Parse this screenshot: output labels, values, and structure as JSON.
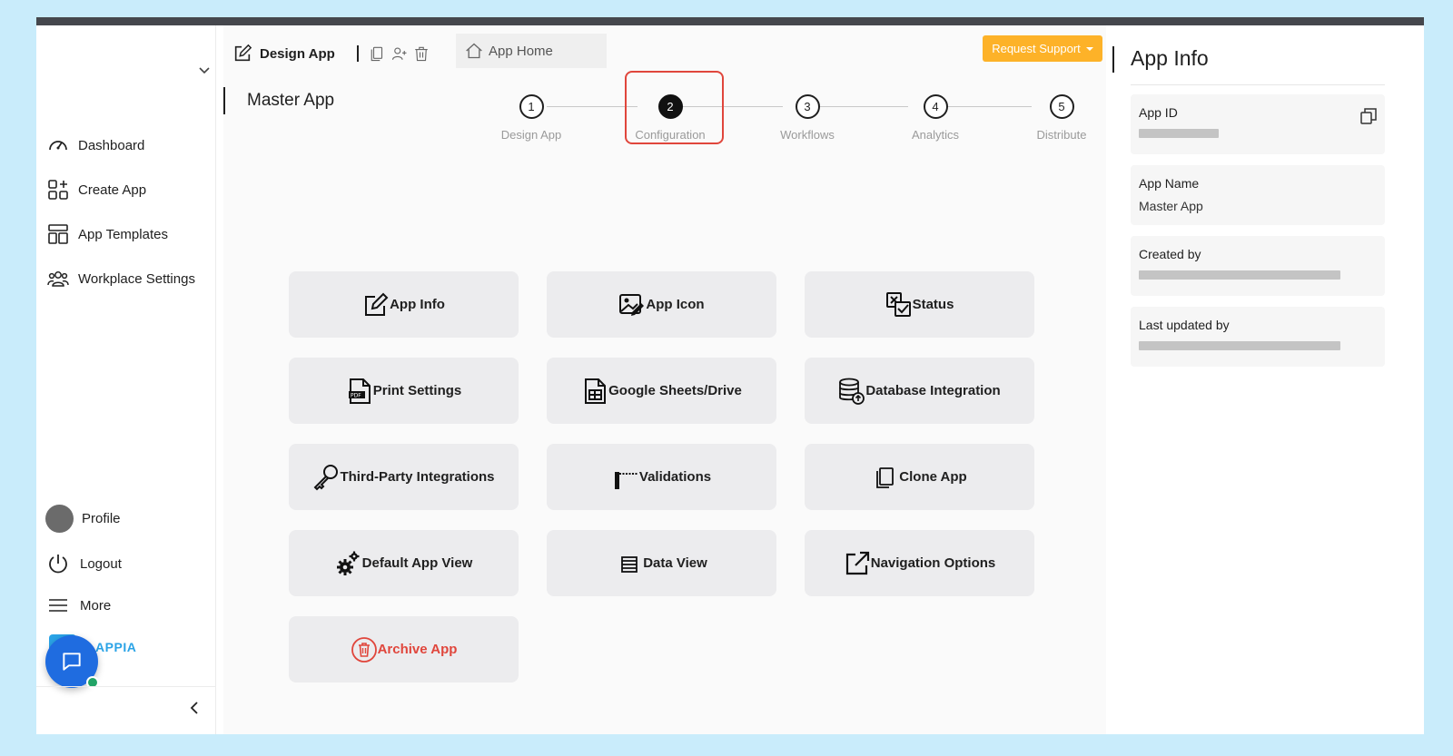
{
  "sidebar": {
    "nav": [
      {
        "label": "Dashboard",
        "icon": "dashboard-icon"
      },
      {
        "label": "Create App",
        "icon": "create-app-icon"
      },
      {
        "label": "App Templates",
        "icon": "app-templates-icon"
      },
      {
        "label": "Workplace Settings",
        "icon": "workplace-settings-icon"
      }
    ],
    "bottom": {
      "profile": "Profile",
      "logout": "Logout",
      "more": "More"
    },
    "brand": "LAPPIA"
  },
  "tabs": {
    "design": "Design App",
    "home": "App Home"
  },
  "header": {
    "request_support": "Request Support",
    "page_title": "Master App"
  },
  "stepper": {
    "active_index": 1,
    "steps": [
      {
        "number": "1",
        "label": "Design App"
      },
      {
        "number": "2",
        "label": "Configuration"
      },
      {
        "number": "3",
        "label": "Workflows"
      },
      {
        "number": "4",
        "label": "Analytics"
      },
      {
        "number": "5",
        "label": "Distribute"
      }
    ]
  },
  "config": {
    "cards": [
      {
        "label": "App Info",
        "icon": "edit-icon"
      },
      {
        "label": "App Icon",
        "icon": "image-edit-icon"
      },
      {
        "label": "Status",
        "icon": "status-icon"
      },
      {
        "label": "Print Settings",
        "icon": "pdf-icon"
      },
      {
        "label": "Google Sheets/Drive",
        "icon": "sheet-icon"
      },
      {
        "label": "Database Integration",
        "icon": "database-icon"
      },
      {
        "label": "Third-Party Integrations",
        "icon": "key-icon"
      },
      {
        "label": "Validations",
        "icon": "barrier-icon"
      },
      {
        "label": "Clone App",
        "icon": "copy-icon"
      },
      {
        "label": "Default App View",
        "icon": "gears-icon"
      },
      {
        "label": "Data View",
        "icon": "list-icon"
      },
      {
        "label": "Navigation Options",
        "icon": "external-link-icon"
      },
      {
        "label": "Archive App",
        "icon": "trash-icon"
      }
    ]
  },
  "app_info": {
    "title": "App Info",
    "app_id_label": "App ID",
    "app_name_label": "App Name",
    "app_name": "Master App",
    "created_by_label": "Created by",
    "last_updated_label": "Last updated by"
  },
  "colors": {
    "accent": "#fdb228",
    "danger": "#e0463c",
    "chat": "#1f6ce0",
    "brand": "#2aa3e6"
  }
}
